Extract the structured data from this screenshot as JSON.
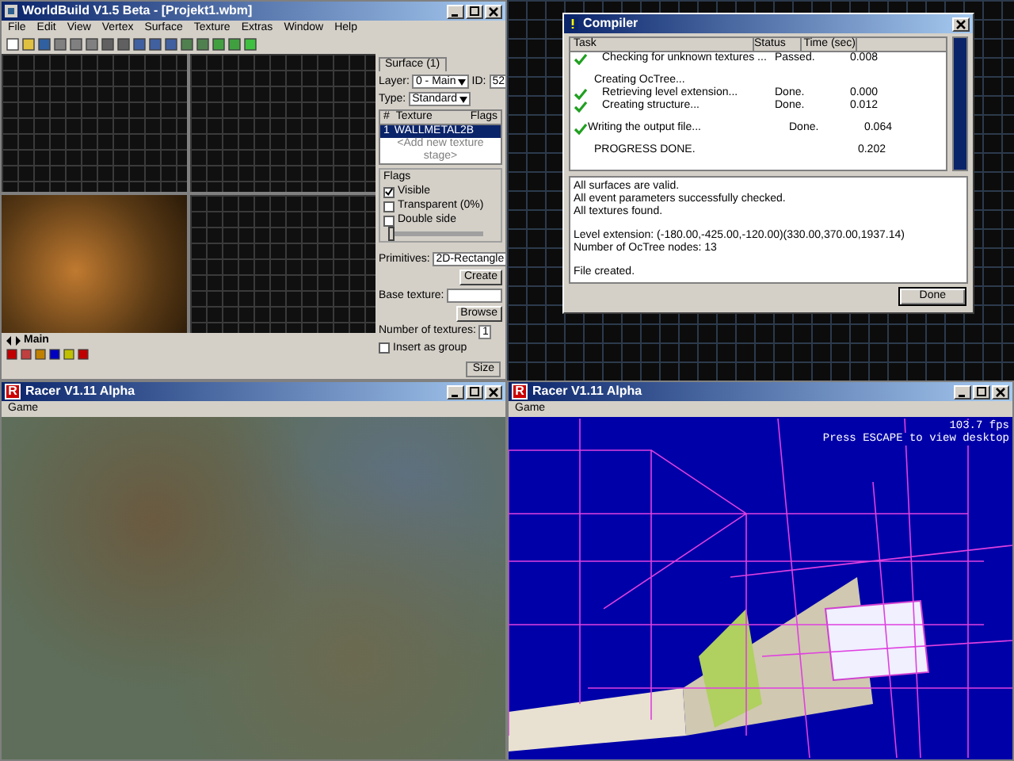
{
  "worldbuild": {
    "title": "WorldBuild V1.5 Beta - [Projekt1.wbm]",
    "menu": [
      "File",
      "Edit",
      "View",
      "Vertex",
      "Surface",
      "Texture",
      "Extras",
      "Window",
      "Help"
    ],
    "viewports": [
      {
        "kind": "grid"
      },
      {
        "kind": "grid"
      },
      {
        "kind": "render"
      },
      {
        "kind": "grid"
      }
    ],
    "surface_panel": {
      "tab": "Surface (1)",
      "layer_label": "Layer:",
      "layer": "0 - Main",
      "id_label": "ID:",
      "id": "52",
      "type_label": "Type:",
      "type": "Standard",
      "columns": [
        "#",
        "Texture",
        "Flags"
      ],
      "rows": [
        {
          "index": "1",
          "texture": "WALLMETAL2B",
          "selected": true
        }
      ],
      "add_row": "<Add new texture stage>",
      "flags_title": "Flags",
      "flags": [
        {
          "label": "Visible",
          "checked": true
        },
        {
          "label": "Transparent (0%)",
          "checked": false
        },
        {
          "label": "Double side",
          "checked": false
        }
      ],
      "transparency_slider": {
        "level": 0
      }
    },
    "primitive_panel": {
      "primitives_label": "Primitives:",
      "primitive": "2D-Rectangle",
      "create_button": "Create",
      "base_texture_label": "Base texture:",
      "browse_button": "Browse",
      "textures_label": "Number of textures:",
      "textures": "1",
      "insert_group": {
        "label": "Insert as group",
        "checked": false
      }
    },
    "layer_tabs": [
      {
        "label": "Main",
        "selected": true
      }
    ],
    "status_bar": [
      "Size"
    ]
  },
  "compiler": {
    "title": "Compiler",
    "columns": [
      "Task",
      "Status",
      "Time (sec)"
    ],
    "rows": [
      {
        "kind": "substep",
        "task": "Checking for unknown textures ...",
        "status": "Passed.",
        "time": "0.008",
        "done": true
      },
      {
        "kind": "group",
        "task": "Creating OcTree...",
        "status": "",
        "time": "",
        "done": false
      },
      {
        "kind": "substep",
        "task": "Retrieving level extension...",
        "status": "Done.",
        "time": "0.000",
        "done": true
      },
      {
        "kind": "substep",
        "task": "Creating structure...",
        "status": "Done.",
        "time": "0.012",
        "done": true
      },
      {
        "kind": "step",
        "task": "Writing the output file...",
        "status": "Done.",
        "time": "0.064",
        "done": true
      },
      {
        "kind": "summary",
        "task": "PROGRESS DONE.",
        "status": "",
        "time": "0.202",
        "done": false
      }
    ],
    "progress": {
      "level": 1
    },
    "log": [
      [
        "All surfaces are valid.",
        "All event parameters successfully checked.",
        "All textures found."
      ],
      [
        "Level extension: (-180.00,-425.00,-120.00)(330.00,370.00,1937.14)",
        "Number of OcTree nodes: 13"
      ],
      [
        "File created."
      ]
    ],
    "done_button": "Done"
  },
  "racer_windows": [
    {
      "logo": "R",
      "title": "Racer V1.11 Alpha",
      "menu": [
        "Game"
      ],
      "kind": "terrain"
    },
    {
      "logo": "R",
      "title": "Racer V1.11 Alpha",
      "menu": [
        "Game"
      ],
      "kind": "wireframe",
      "overlay": [
        "103.7 fps",
        "Press ESCAPE to view desktop"
      ]
    }
  ]
}
